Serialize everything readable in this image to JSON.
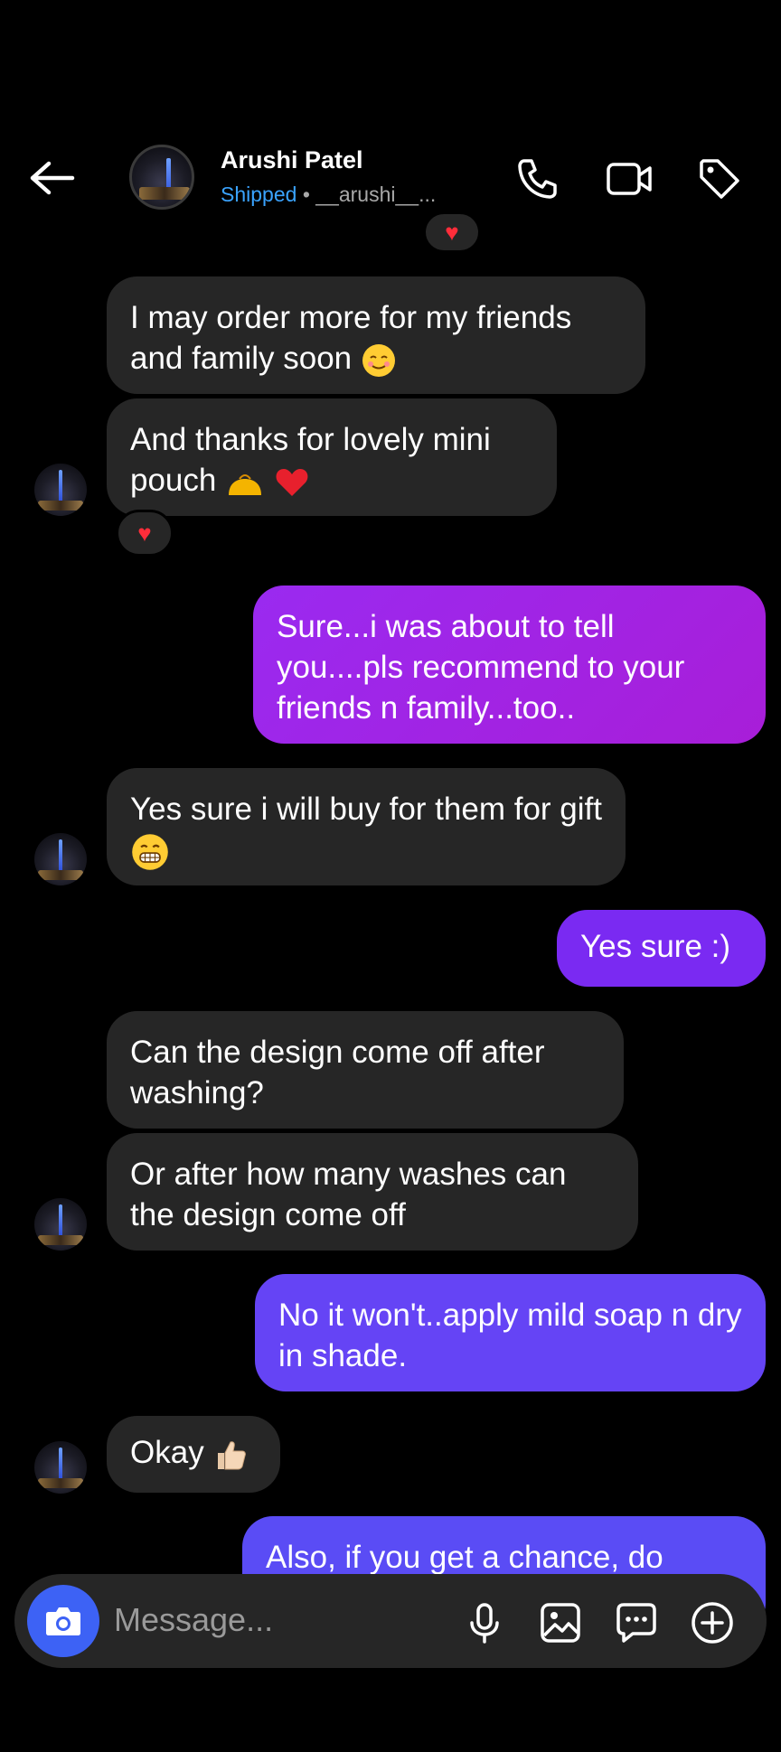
{
  "header": {
    "name": "Arushi Patel",
    "status": "Shipped",
    "separator": "•",
    "username": "__arushi__..."
  },
  "messages": [
    {
      "side": "in",
      "text": "I may order more for my friends and family soon"
    },
    {
      "side": "in",
      "text": "And thanks for lovely mini pouch"
    },
    {
      "side": "out",
      "text": "Sure...i was about to tell you....pls recommend  to your friends  n family...too.."
    },
    {
      "side": "in",
      "text": "Yes sure i will buy for them for gift"
    },
    {
      "side": "out",
      "text": "Yes sure :)"
    },
    {
      "side": "in",
      "text": "Can the design come off after washing?"
    },
    {
      "side": "in",
      "text": "Or after how many washes can the design come off"
    },
    {
      "side": "out",
      "text": "No it won't..apply mild soap n dry in shade."
    },
    {
      "side": "in",
      "text": "Okay"
    },
    {
      "side": "out",
      "text": "Also, if you get a chance, do"
    }
  ],
  "composer": {
    "placeholder": "Message..."
  },
  "colors": {
    "background": "#000000",
    "incoming_bubble": "#262626",
    "outgoing_purple": "#a020e0",
    "outgoing_blue": "#6a40f5",
    "status_blue": "#3aa3ff",
    "camera_button": "#3d62f5"
  },
  "icons": [
    "back-arrow-icon",
    "phone-icon",
    "video-icon",
    "tag-icon",
    "camera-icon",
    "microphone-icon",
    "gallery-icon",
    "sticker-icon",
    "add-icon"
  ]
}
